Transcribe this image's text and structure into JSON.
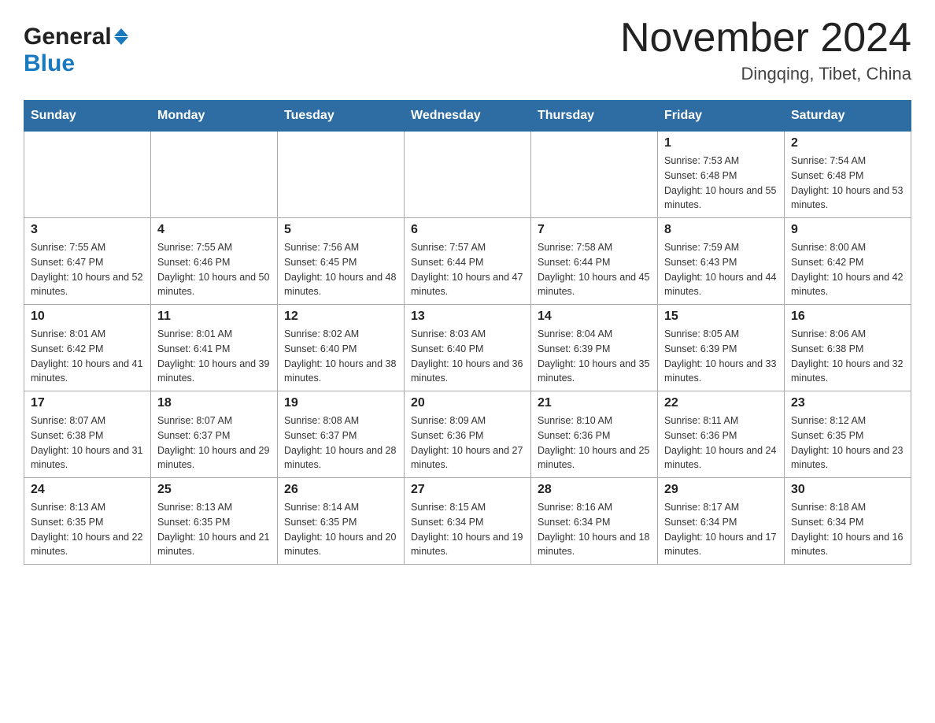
{
  "header": {
    "logo_general": "General",
    "logo_blue": "Blue",
    "month_title": "November 2024",
    "location": "Dingqing, Tibet, China"
  },
  "calendar": {
    "days_of_week": [
      "Sunday",
      "Monday",
      "Tuesday",
      "Wednesday",
      "Thursday",
      "Friday",
      "Saturday"
    ],
    "weeks": [
      [
        {
          "day": "",
          "info": ""
        },
        {
          "day": "",
          "info": ""
        },
        {
          "day": "",
          "info": ""
        },
        {
          "day": "",
          "info": ""
        },
        {
          "day": "",
          "info": ""
        },
        {
          "day": "1",
          "info": "Sunrise: 7:53 AM\nSunset: 6:48 PM\nDaylight: 10 hours and 55 minutes."
        },
        {
          "day": "2",
          "info": "Sunrise: 7:54 AM\nSunset: 6:48 PM\nDaylight: 10 hours and 53 minutes."
        }
      ],
      [
        {
          "day": "3",
          "info": "Sunrise: 7:55 AM\nSunset: 6:47 PM\nDaylight: 10 hours and 52 minutes."
        },
        {
          "day": "4",
          "info": "Sunrise: 7:55 AM\nSunset: 6:46 PM\nDaylight: 10 hours and 50 minutes."
        },
        {
          "day": "5",
          "info": "Sunrise: 7:56 AM\nSunset: 6:45 PM\nDaylight: 10 hours and 48 minutes."
        },
        {
          "day": "6",
          "info": "Sunrise: 7:57 AM\nSunset: 6:44 PM\nDaylight: 10 hours and 47 minutes."
        },
        {
          "day": "7",
          "info": "Sunrise: 7:58 AM\nSunset: 6:44 PM\nDaylight: 10 hours and 45 minutes."
        },
        {
          "day": "8",
          "info": "Sunrise: 7:59 AM\nSunset: 6:43 PM\nDaylight: 10 hours and 44 minutes."
        },
        {
          "day": "9",
          "info": "Sunrise: 8:00 AM\nSunset: 6:42 PM\nDaylight: 10 hours and 42 minutes."
        }
      ],
      [
        {
          "day": "10",
          "info": "Sunrise: 8:01 AM\nSunset: 6:42 PM\nDaylight: 10 hours and 41 minutes."
        },
        {
          "day": "11",
          "info": "Sunrise: 8:01 AM\nSunset: 6:41 PM\nDaylight: 10 hours and 39 minutes."
        },
        {
          "day": "12",
          "info": "Sunrise: 8:02 AM\nSunset: 6:40 PM\nDaylight: 10 hours and 38 minutes."
        },
        {
          "day": "13",
          "info": "Sunrise: 8:03 AM\nSunset: 6:40 PM\nDaylight: 10 hours and 36 minutes."
        },
        {
          "day": "14",
          "info": "Sunrise: 8:04 AM\nSunset: 6:39 PM\nDaylight: 10 hours and 35 minutes."
        },
        {
          "day": "15",
          "info": "Sunrise: 8:05 AM\nSunset: 6:39 PM\nDaylight: 10 hours and 33 minutes."
        },
        {
          "day": "16",
          "info": "Sunrise: 8:06 AM\nSunset: 6:38 PM\nDaylight: 10 hours and 32 minutes."
        }
      ],
      [
        {
          "day": "17",
          "info": "Sunrise: 8:07 AM\nSunset: 6:38 PM\nDaylight: 10 hours and 31 minutes."
        },
        {
          "day": "18",
          "info": "Sunrise: 8:07 AM\nSunset: 6:37 PM\nDaylight: 10 hours and 29 minutes."
        },
        {
          "day": "19",
          "info": "Sunrise: 8:08 AM\nSunset: 6:37 PM\nDaylight: 10 hours and 28 minutes."
        },
        {
          "day": "20",
          "info": "Sunrise: 8:09 AM\nSunset: 6:36 PM\nDaylight: 10 hours and 27 minutes."
        },
        {
          "day": "21",
          "info": "Sunrise: 8:10 AM\nSunset: 6:36 PM\nDaylight: 10 hours and 25 minutes."
        },
        {
          "day": "22",
          "info": "Sunrise: 8:11 AM\nSunset: 6:36 PM\nDaylight: 10 hours and 24 minutes."
        },
        {
          "day": "23",
          "info": "Sunrise: 8:12 AM\nSunset: 6:35 PM\nDaylight: 10 hours and 23 minutes."
        }
      ],
      [
        {
          "day": "24",
          "info": "Sunrise: 8:13 AM\nSunset: 6:35 PM\nDaylight: 10 hours and 22 minutes."
        },
        {
          "day": "25",
          "info": "Sunrise: 8:13 AM\nSunset: 6:35 PM\nDaylight: 10 hours and 21 minutes."
        },
        {
          "day": "26",
          "info": "Sunrise: 8:14 AM\nSunset: 6:35 PM\nDaylight: 10 hours and 20 minutes."
        },
        {
          "day": "27",
          "info": "Sunrise: 8:15 AM\nSunset: 6:34 PM\nDaylight: 10 hours and 19 minutes."
        },
        {
          "day": "28",
          "info": "Sunrise: 8:16 AM\nSunset: 6:34 PM\nDaylight: 10 hours and 18 minutes."
        },
        {
          "day": "29",
          "info": "Sunrise: 8:17 AM\nSunset: 6:34 PM\nDaylight: 10 hours and 17 minutes."
        },
        {
          "day": "30",
          "info": "Sunrise: 8:18 AM\nSunset: 6:34 PM\nDaylight: 10 hours and 16 minutes."
        }
      ]
    ]
  }
}
